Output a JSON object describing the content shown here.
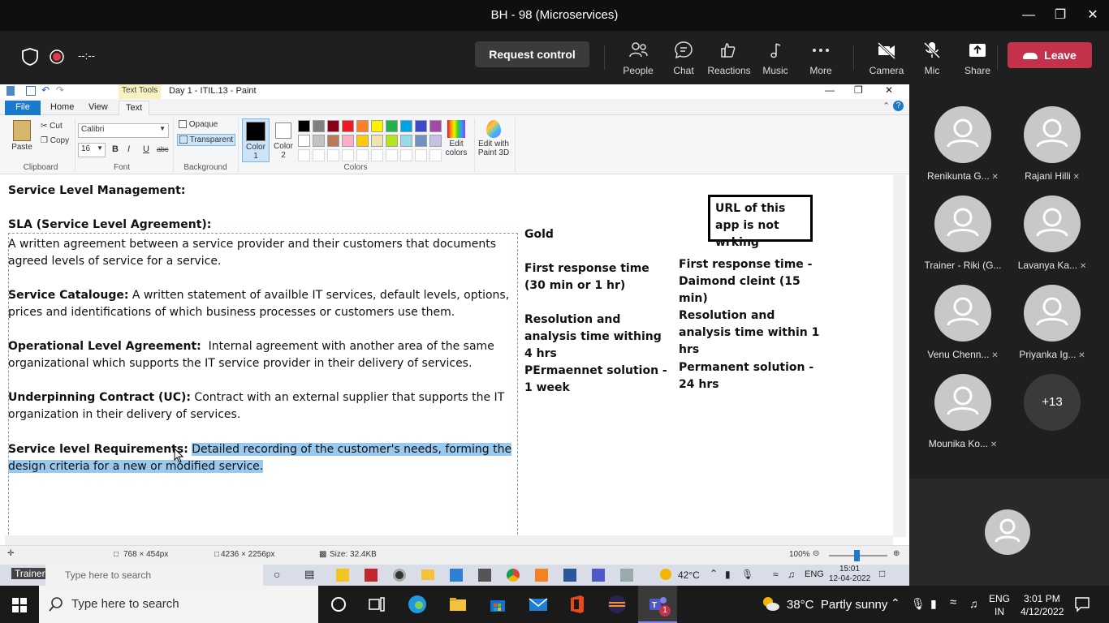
{
  "window": {
    "title": "BH - 98 (Microservices)"
  },
  "meeting_bar": {
    "timer": "--:--",
    "request_control_label": "Request control",
    "items": [
      {
        "label": "People",
        "icon": "people-icon"
      },
      {
        "label": "Chat",
        "icon": "chat-icon"
      },
      {
        "label": "Reactions",
        "icon": "reactions-icon"
      },
      {
        "label": "Music",
        "icon": "music-icon"
      },
      {
        "label": "More",
        "icon": "more-icon"
      },
      {
        "label": "Camera",
        "icon": "camera-off-icon"
      },
      {
        "label": "Mic",
        "icon": "mic-off-icon"
      },
      {
        "label": "Share",
        "icon": "share-icon"
      }
    ],
    "leave_label": "Leave",
    "leave_color": "#c4314b"
  },
  "paint": {
    "contextual_tab": "Text Tools",
    "doc_title": "Day 1 - ITIL.13 - Paint",
    "tabs": [
      "File",
      "Home",
      "View",
      "Text"
    ],
    "clipboard": {
      "paste": "Paste",
      "cut": "Cut",
      "copy": "Copy",
      "group": "Clipboard"
    },
    "font": {
      "family": "Calibri",
      "size": "16",
      "group": "Font",
      "bold": "B",
      "italic": "I",
      "underline": "U",
      "strike": "abc"
    },
    "background": {
      "opaque": "Opaque",
      "transparent": "Transparent",
      "group": "Background"
    },
    "colors": {
      "color1": "Color 1",
      "color2": "Color 2",
      "edit": "Edit colors",
      "paint3d": "Edit with Paint 3D",
      "group": "Colors"
    },
    "status": {
      "selection": "768 × 454px",
      "canvas": "4236 × 2256px",
      "size": "Size: 32.4KB",
      "zoom": "100%"
    }
  },
  "canvas": {
    "heading": "Service Level Management:",
    "sla_title": "SLA (Service Level Agreement):",
    "sla_line1": "A written agreement between a service provider and their customers that documents",
    "sla_line2": "agreed levels of service for a service.",
    "catalogue_label": "Service Catalouge:",
    "catalogue_line1": " A written statement of availble IT services, default levels, options,",
    "catalogue_line2": "prices and identifications of which business processes or customers use them.",
    "ola_label": "Operational Level Agreement:",
    "ola_line1": "  Internal agreement with another area of the same",
    "ola_line2": "organizational which supports the IT service provider in their delivery of services.",
    "uc_label": "Underpinning Contract (UC):",
    "uc_line1": " Contract with an external supplier that supports the IT",
    "uc_line2": "organization in their delivery of services.",
    "slr_label": "Service level Requirements:",
    "slr_line1": "Detailed recording of the customer's needs, forming the",
    "slr_line2": "design criteria for a new or modified service.",
    "gold": "Gold",
    "gold_frt": "First response time (30 min or 1 hr)",
    "gold_ra": "Resolution and analysis time withing 4 hrs",
    "gold_ps": "PErmaennet solution - 1 week",
    "dia_frt": "First response time - Daimond cleint (15 min)",
    "dia_ra": "Resolution and analysis time within 1 hrs",
    "dia_ps": "Permanent solution - 24 hrs",
    "note": "URL of this app is not wrking"
  },
  "inner_taskbar": {
    "presenter": "Trainer - Riki (Guest)",
    "search": "Type here to search",
    "temp": "42°C",
    "lang": "ENG",
    "time": "15:01",
    "date": "12-04-2022"
  },
  "participants": [
    {
      "name": "Renikunta G...",
      "muted": true
    },
    {
      "name": "Rajani Hilli",
      "muted": true
    },
    {
      "name": "Trainer - Riki (G...",
      "muted": false
    },
    {
      "name": "Lavanya Ka...",
      "muted": true
    },
    {
      "name": "Venu Chenn...",
      "muted": true
    },
    {
      "name": "Priyanka Ig...",
      "muted": true
    },
    {
      "name": "Mounika Ko...",
      "muted": true
    }
  ],
  "more_participants": "+13",
  "taskbar": {
    "search_placeholder": "Type here to search",
    "weather": "38°C  Partly sunny",
    "lang1": "ENG",
    "lang2": "IN",
    "time": "3:01 PM",
    "date": "4/12/2022",
    "teams_badge": "1"
  }
}
